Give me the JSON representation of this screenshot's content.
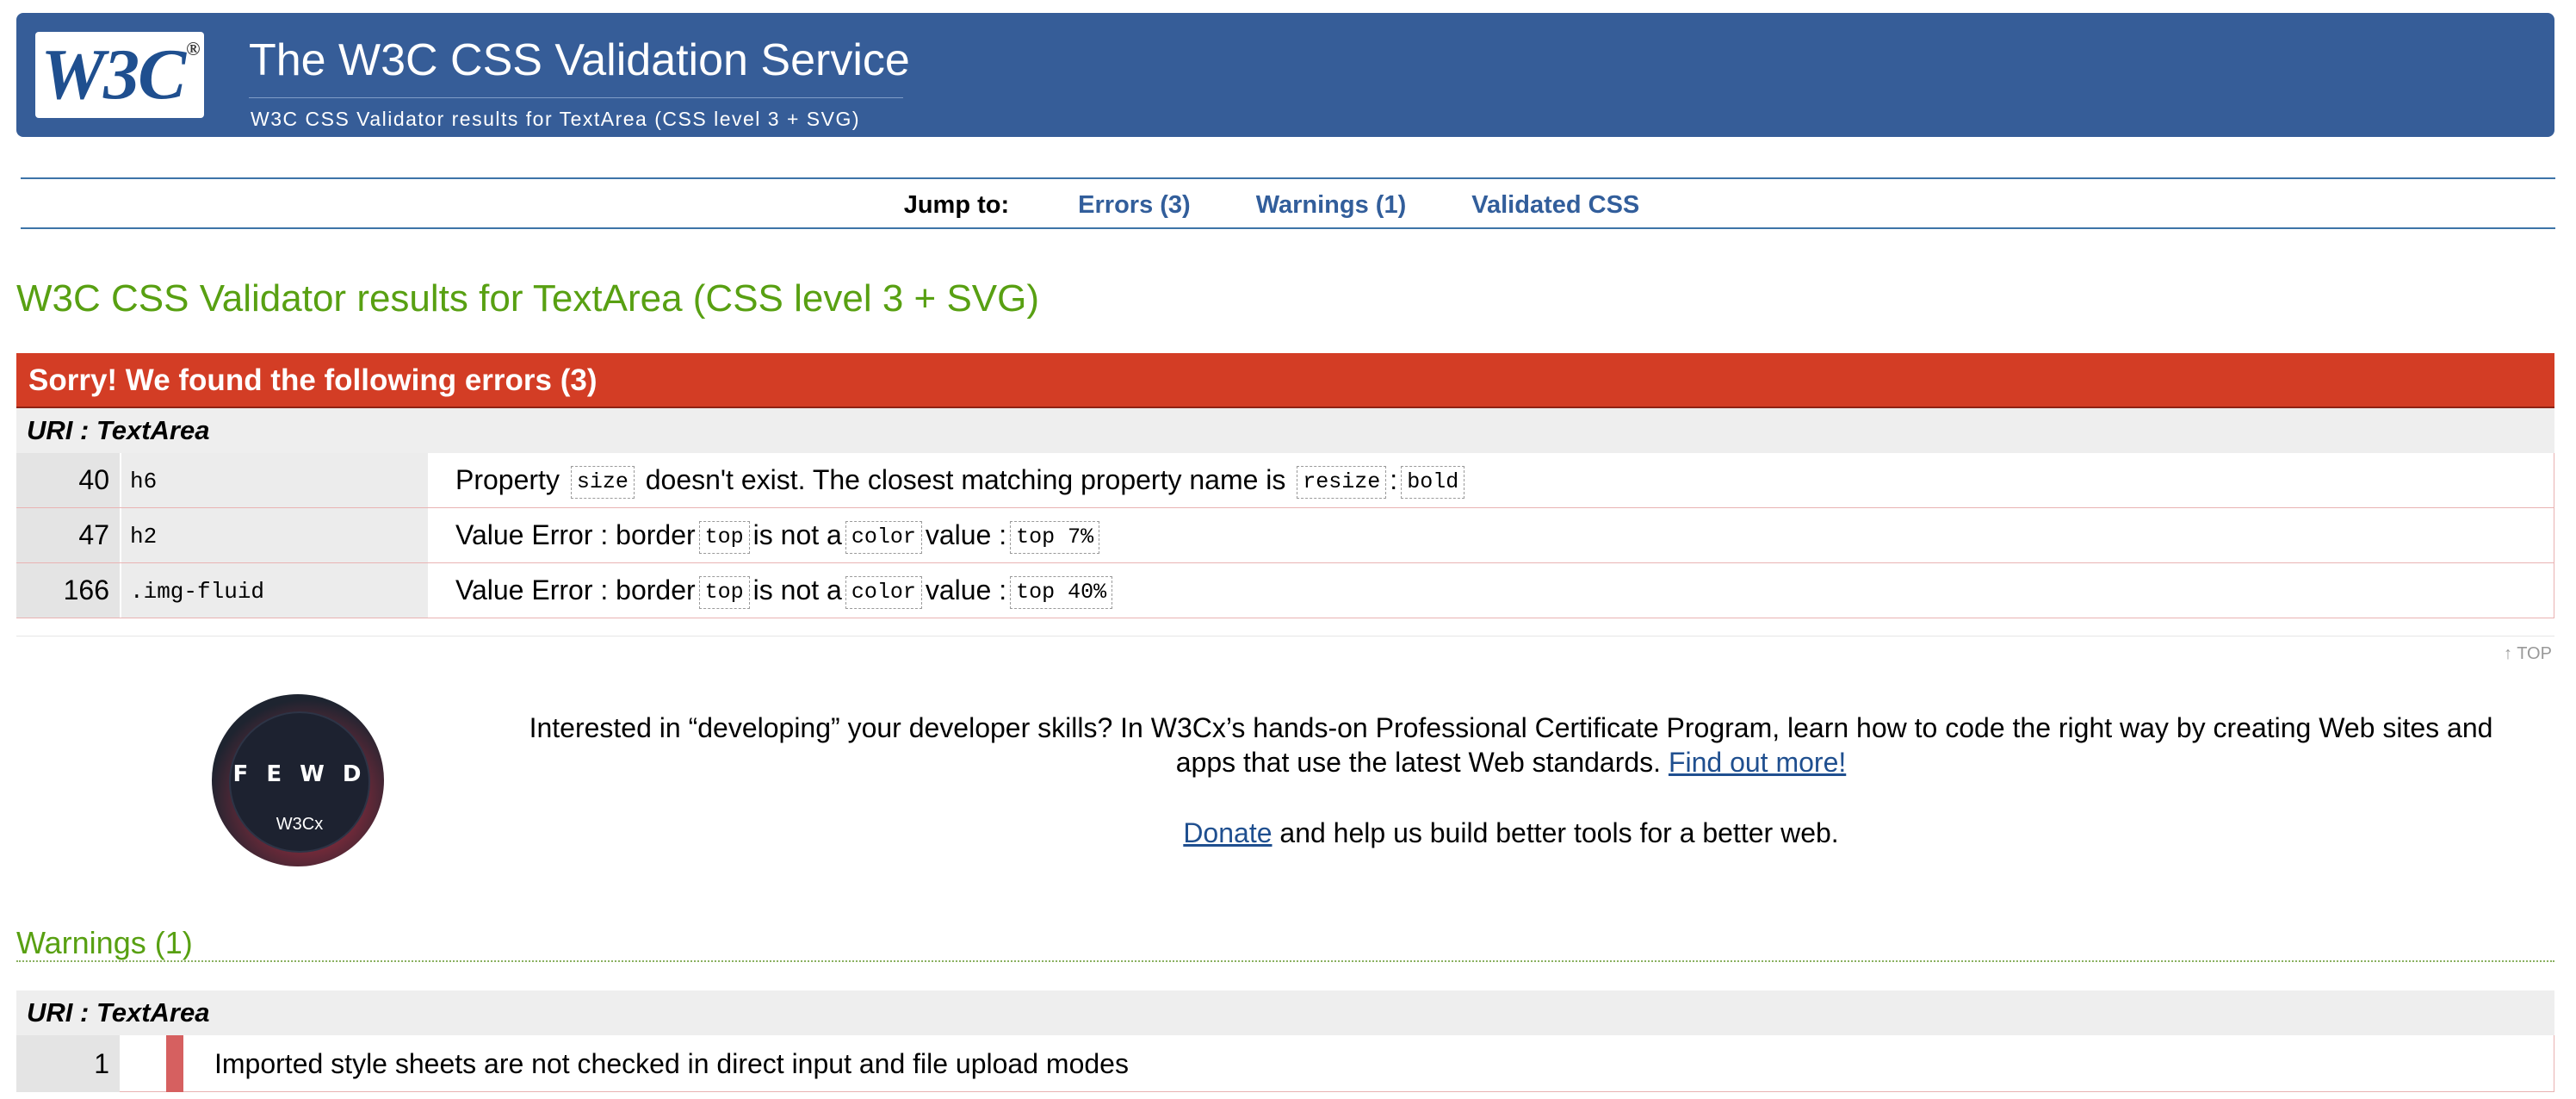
{
  "banner": {
    "logo_text": "W3C",
    "logo_mark": "®",
    "title": "The W3C CSS Validation Service",
    "subtitle": "W3C CSS Validator results for TextArea (CSS level 3 + SVG)"
  },
  "jump": {
    "label": "Jump to:",
    "links": [
      "Errors (3)",
      "Warnings (1)",
      "Validated CSS"
    ]
  },
  "results_title": "W3C CSS Validator results for TextArea (CSS level 3 + SVG)",
  "errors": {
    "header": "Sorry! We found the following errors (3)",
    "uri": "URI : TextArea",
    "rows": [
      {
        "line": "40",
        "context": "h6",
        "m1": "Property",
        "c1": "size",
        "m2": "doesn't exist. The closest matching property name is",
        "c2": "resize",
        "m3": ":",
        "c3": "bold"
      },
      {
        "line": "47",
        "context": "h2",
        "m1": "Value Error : border",
        "c1": "top",
        "m2": "is not a",
        "c2": "color",
        "m3": "value :",
        "c3": "top 7%"
      },
      {
        "line": "166",
        "context": ".img-fluid",
        "m1": "Value Error : border",
        "c1": "top",
        "m2": "is not a",
        "c2": "color",
        "m3": "value :",
        "c3": "top 40%"
      }
    ]
  },
  "top_link": "↑ TOP",
  "badge": {
    "text": "F E W D",
    "brand": "W3Cx"
  },
  "promo": {
    "text": "Interested in “developing” your developer skills? In W3Cx’s hands-on Professional Certificate Program, learn how to code the right way by creating Web sites and apps that use the latest Web standards.",
    "link": "Find out more!",
    "donate_link": "Donate",
    "donate_text": "and help us build better tools for a better web."
  },
  "warnings": {
    "title": "Warnings (1)",
    "uri": "URI : TextArea",
    "rows": [
      {
        "line": "1",
        "message": "Imported style sheets are not checked in direct input and file upload modes"
      }
    ]
  },
  "colors": {
    "banner_bg": "#365d98",
    "error_header": "#d33d25",
    "heading_green": "#58a012",
    "link_blue": "#325e9b"
  }
}
